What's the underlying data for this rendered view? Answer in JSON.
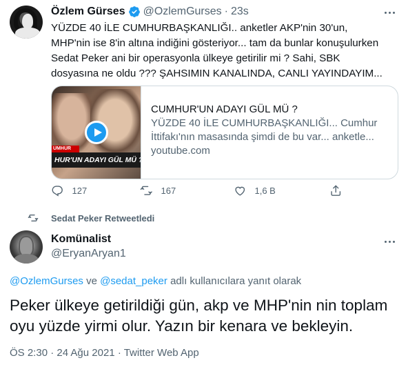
{
  "tweet1": {
    "author_name": "Özlem Gürses",
    "author_handle": "@OzlemGurses",
    "separator": "·",
    "time": "23s",
    "text": "YÜZDE 40 İLE CUMHURBAŞKANLIĞI.. anketler AKP'nin 30'un,\nMHP'nin ise 8'in altına indiğini gösteriyor... tam da bunlar konuşulurken\nSedat Peker ani bir operasyonla ülkeye getirilir mi ? Sahi, SBK\ndosyasına ne oldu ??? ŞAHSIMIN KANALINDA, CANLI YAYINDAYIM...",
    "card": {
      "thumb_banner": "HUR'UN ADAYI GÜL MÜ ?",
      "thumb_tag": "UMHUR",
      "title": "CUMHUR'UN ADAYI GÜL MÜ ?",
      "description": "YÜZDE 40 İLE CUMHURBAŞKANLIĞI... Cumhur İttifakı'nın masasında şimdi de bu var... anketle...",
      "domain": "youtube.com"
    },
    "actions": {
      "reply_count": "127",
      "retweet_count": "167",
      "like_count": "1,6 B"
    }
  },
  "retweet_banner": "Sedat Peker Retweetledi",
  "tweet2": {
    "author_name": "Komünalist",
    "author_handle": "@EryanAryan1",
    "reply_mention_1": "@OzlemGurses",
    "reply_connector": " ve ",
    "reply_mention_2": "@sedat_peker",
    "reply_suffix": " adlı kullanıcılara yanıt olarak",
    "text": "Peker ülkeye getirildiği gün, akp ve MHP'nin nin toplam\noyu yüzde yirmi olur. Yazın bir kenara ve bekleyin.",
    "time": "ÖS 2:30",
    "dot1": " · ",
    "date": "24 Ağu 2021",
    "dot2": " · ",
    "source": "Twitter Web App"
  },
  "colors": {
    "text_primary": "#0f1419",
    "text_secondary": "#536471",
    "accent": "#1d9bf0",
    "border": "#cfd9de"
  }
}
